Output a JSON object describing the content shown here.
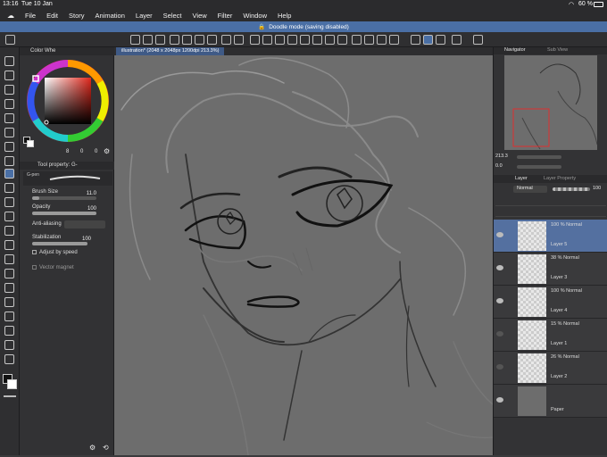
{
  "status": {
    "time": "13:16",
    "date": "Tue 10 Jan",
    "battery": "60 %"
  },
  "menu": [
    "File",
    "Edit",
    "Story",
    "Animation",
    "Layer",
    "Select",
    "View",
    "Filter",
    "Window",
    "Help"
  ],
  "banner": {
    "text": "Doodle mode (saving disabled)"
  },
  "document": {
    "tab": "illustration* (2048 x 2048px 1200dpi 213.3%)"
  },
  "color_panel": {
    "title": "Color Whe",
    "values": [
      "8",
      "0",
      "0"
    ]
  },
  "tool_panel": {
    "title": "Tool property: G-",
    "brush": "G-pen"
  },
  "tool_props": {
    "brush_size": {
      "label": "Brush Size",
      "value": "11.0",
      "level": 0.11
    },
    "opacity": {
      "label": "Opacity",
      "value": "100",
      "level": 1.0
    },
    "anti_aliasing": {
      "label": "Anti-aliasing"
    },
    "stabilization": {
      "label": "Stabilization",
      "value": "100",
      "level": 1.0
    },
    "adjust_by_speed": "Adjust by speed",
    "vector_magnet": "Vector magnet"
  },
  "navigator": {
    "tabs": [
      "Navigator",
      "Sub View"
    ],
    "zoom": "213.3",
    "rotate": "0.0"
  },
  "layer_panel": {
    "tabs": [
      "Layer",
      "Layer Property"
    ],
    "blend_mode": "Normal",
    "opacity": "100",
    "layers": [
      {
        "mode": "100 %  Normal",
        "name": "Layer 5",
        "selected": true
      },
      {
        "mode": "38 %  Normal",
        "name": "Layer 3",
        "selected": false
      },
      {
        "mode": "100 %  Normal",
        "name": "Layer 4",
        "selected": false
      },
      {
        "mode": "15 %  Normal",
        "name": "Layer 1",
        "selected": false
      },
      {
        "mode": "26 %  Normal",
        "name": "Layer 2",
        "selected": false
      },
      {
        "mode": "",
        "name": "Paper",
        "selected": false
      }
    ]
  }
}
